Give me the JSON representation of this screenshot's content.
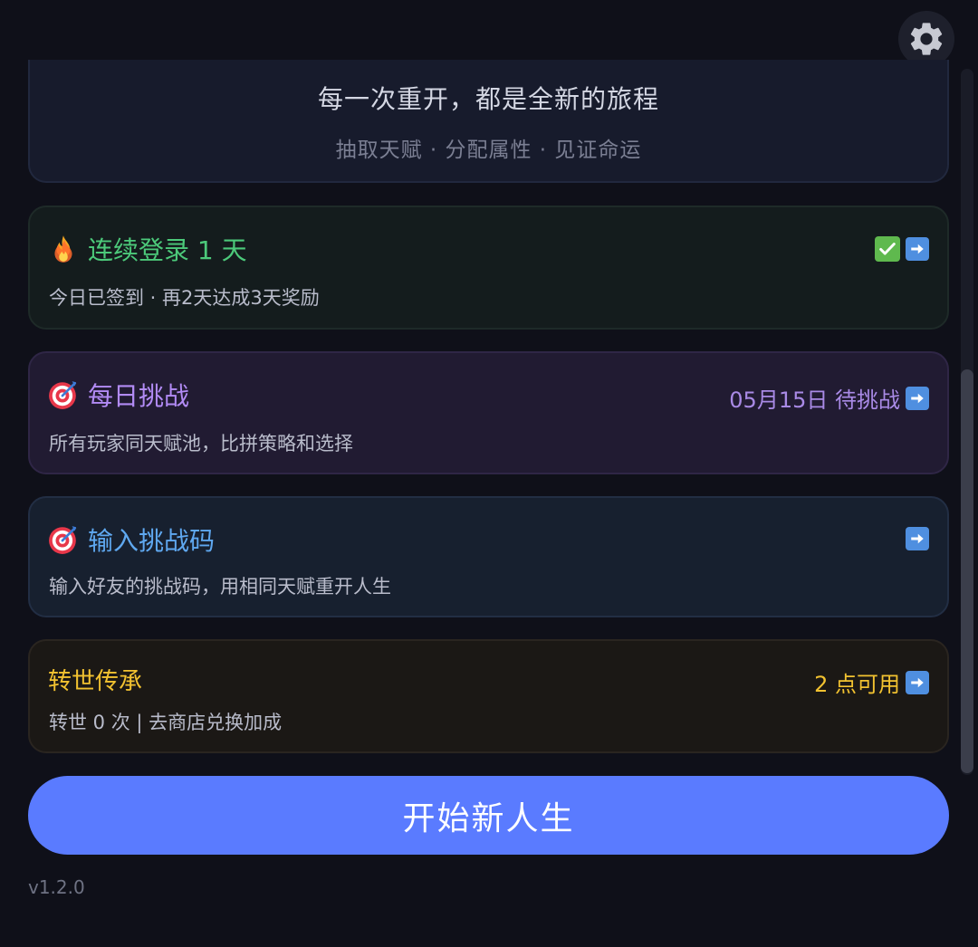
{
  "hero": {
    "title": "每一次重开，都是全新的旅程",
    "subtitle": "抽取天赋 · 分配属性 · 见证命运"
  },
  "login_card": {
    "icon": "fire-icon",
    "title": "连续登录 1 天",
    "description": "今日已签到 · 再2天达成3天奖励",
    "title_color": "#4cc97a",
    "status_icon": "check-mark-icon"
  },
  "daily_challenge_card": {
    "icon": "target-icon",
    "title": "每日挑战",
    "status": "05月15日 待挑战",
    "description": "所有玩家同天赋池，比拼策略和选择",
    "title_color": "#b28bf5"
  },
  "challenge_code_card": {
    "icon": "target-icon",
    "title": "输入挑战码",
    "description": "输入好友的挑战码，用相同天赋重开人生",
    "title_color": "#5fa8f0"
  },
  "rebirth_card": {
    "title": "转世传承",
    "status": "2 点可用",
    "description": "转世 0 次 | 去商店兑换加成",
    "title_color": "#f2c230"
  },
  "start_button": {
    "label": "开始新人生",
    "color": "#5a7bff"
  },
  "footer": {
    "version": "v1.2.0"
  }
}
